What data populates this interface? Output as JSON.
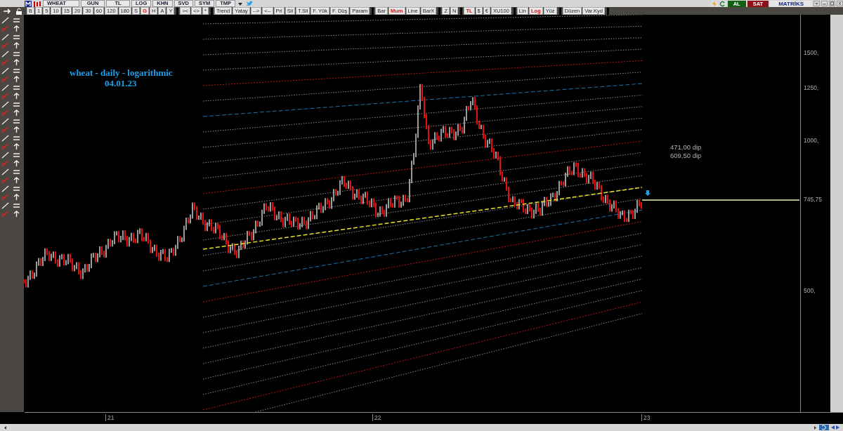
{
  "toolbar_top": {
    "symbol": "WHEAT",
    "fields": [
      "GUN",
      "TL"
    ],
    "buttons": [
      "LOG",
      "KHN",
      "SVD",
      "SYM",
      "TMP"
    ]
  },
  "toolbar_groups": [
    [
      {
        "label": "B",
        "selected": false
      },
      {
        "label": "1",
        "selected": false
      },
      {
        "label": "5",
        "selected": false
      },
      {
        "label": "10",
        "selected": false
      },
      {
        "label": "15",
        "selected": false
      },
      {
        "label": "20",
        "selected": false
      },
      {
        "label": "30",
        "selected": false
      },
      {
        "label": "60",
        "selected": false
      },
      {
        "label": "120",
        "selected": false
      },
      {
        "label": "180",
        "selected": false
      },
      {
        "label": "S",
        "selected": false
      },
      {
        "label": "G",
        "selected": true
      },
      {
        "label": "H",
        "selected": false
      },
      {
        "label": "A",
        "selected": false
      },
      {
        "label": "Y",
        "selected": false
      }
    ],
    [
      {
        "label": "><",
        "selected": false
      },
      {
        "label": "<>",
        "selected": false
      },
      {
        "label": "*",
        "selected": false
      }
    ],
    [
      {
        "label": "Trend",
        "selected": false
      },
      {
        "label": "Yatay",
        "selected": false
      },
      {
        "label": "-->",
        "selected": false
      },
      {
        "label": "<--",
        "selected": false
      },
      {
        "label": "Prl",
        "selected": false
      },
      {
        "label": "Sil",
        "selected": false
      },
      {
        "label": "T.Sil",
        "selected": false
      },
      {
        "label": "F. Yük",
        "selected": false
      },
      {
        "label": "F. Düş",
        "selected": false
      },
      {
        "label": "Param",
        "selected": false
      }
    ],
    [
      {
        "label": "Bar",
        "selected": false
      },
      {
        "label": "Mum",
        "selected": true
      },
      {
        "label": "Line",
        "selected": false
      },
      {
        "label": "BarX",
        "selected": false
      }
    ],
    [
      {
        "label": "Z",
        "selected": false
      },
      {
        "label": "N",
        "selected": false
      }
    ],
    [
      {
        "label": "TL",
        "selected": true
      },
      {
        "label": "$",
        "selected": false
      },
      {
        "label": "€",
        "selected": false
      },
      {
        "label": "XU100",
        "selected": false
      }
    ],
    [
      {
        "label": "Lin",
        "selected": false
      },
      {
        "label": "Log",
        "selected": true
      },
      {
        "label": "Yüz",
        "selected": false
      }
    ],
    [
      {
        "label": "Düzen",
        "selected": false
      },
      {
        "label": "Var.Kyd",
        "selected": false
      }
    ]
  ],
  "trade_buttons": {
    "buy": "AL",
    "sell": "SAT",
    "brand": "MATRİKS"
  },
  "chart": {
    "title": "wheat - daily - logarithmic",
    "date": "04.01.23",
    "notes": [
      "471,00 dip",
      "609,50 dip"
    ],
    "price_labels": [
      "1500,",
      "1250,",
      "1000,",
      "500,"
    ],
    "last_price": "745,75",
    "x_labels": [
      "21",
      "22",
      "23"
    ]
  }
}
